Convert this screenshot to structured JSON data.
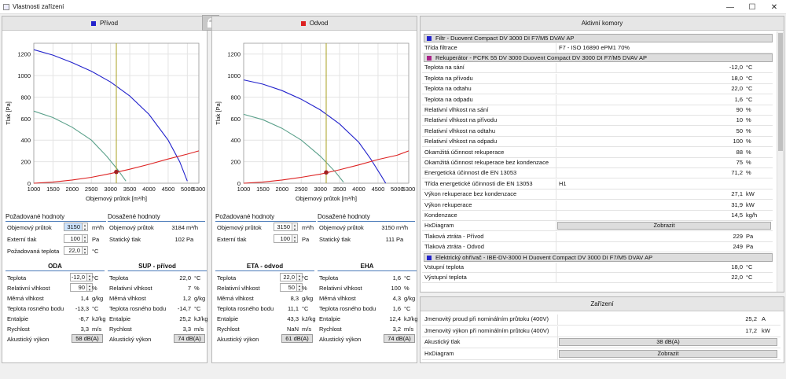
{
  "window": {
    "title": "Vlastnosti zařízení",
    "min": "—",
    "max": "☐",
    "close": "✕"
  },
  "colors": {
    "blue": "#2222cc",
    "red": "#dd2222",
    "green": "#5aa08a",
    "olive": "#aaa020"
  },
  "left": {
    "header": "Přívod",
    "color": "#2222cc",
    "chart_data": {
      "type": "line",
      "xlabel": "Objemový průtok [m³/h]",
      "ylabel": "Tlak [Pa]",
      "xlim": [
        1000,
        5300
      ],
      "ylim": [
        0,
        1300
      ],
      "xticks": [
        1000,
        1500,
        2000,
        2500,
        3000,
        3500,
        4000,
        4500,
        5000,
        5300
      ],
      "yticks": [
        0,
        200,
        400,
        600,
        800,
        1000,
        1200
      ],
      "series": [
        {
          "color": "#2222cc",
          "points": [
            [
              1000,
              1240
            ],
            [
              1500,
              1190
            ],
            [
              2000,
              1120
            ],
            [
              2500,
              1040
            ],
            [
              3000,
              940
            ],
            [
              3500,
              810
            ],
            [
              4000,
              640
            ],
            [
              4500,
              400
            ],
            [
              4800,
              200
            ],
            [
              5000,
              20
            ]
          ]
        },
        {
          "color": "#5aa08a",
          "points": [
            [
              1000,
              670
            ],
            [
              1500,
              610
            ],
            [
              2000,
              520
            ],
            [
              2500,
              400
            ],
            [
              2900,
              250
            ],
            [
              3200,
              120
            ],
            [
              3400,
              20
            ]
          ]
        },
        {
          "color": "#dd2222",
          "points": [
            [
              1000,
              0
            ],
            [
              1500,
              10
            ],
            [
              2000,
              30
            ],
            [
              2500,
              55
            ],
            [
              3000,
              90
            ],
            [
              3500,
              130
            ],
            [
              4000,
              175
            ],
            [
              4500,
              225
            ],
            [
              5000,
              270
            ],
            [
              5300,
              300
            ]
          ]
        }
      ],
      "vline": 3150,
      "point": [
        3150,
        105
      ]
    },
    "req": {
      "title": "Požadované hodnoty",
      "flow_label": "Objemový průtok",
      "flow": "3150",
      "flow_unit": "m³/h",
      "ext_label": "Externí tlak",
      "ext": "100",
      "ext_unit": "Pa",
      "temp_label": "Požadovaná teplota",
      "temp": "22,0",
      "temp_unit": "°C"
    },
    "ach": {
      "title": "Dosažené hodnoty",
      "flow_label": "Objemový průtok",
      "flow": "3184",
      "flow_unit": "m³/h",
      "stat_label": "Statický tlak",
      "stat": "102",
      "stat_unit": "Pa"
    },
    "a": {
      "title": "ODA",
      "rows": [
        {
          "label": "Teplota",
          "value": "-12,0",
          "unit": "°C",
          "input": true
        },
        {
          "label": "Relativní vlhkost",
          "value": "90",
          "unit": "%",
          "input": true
        },
        {
          "label": "Měrná vlhkost",
          "value": "1,4",
          "unit": "g/kg"
        },
        {
          "label": "Teplota rosného bodu",
          "value": "-13,3",
          "unit": "°C"
        },
        {
          "label": "Entalpie",
          "value": "-8,7",
          "unit": "kJ/kg"
        },
        {
          "label": "Rychlost",
          "value": "3,3",
          "unit": "m/s"
        }
      ],
      "ac_label": "Akustický výkon",
      "ac": "58 dB(A)"
    },
    "b": {
      "title": "SUP - přívod",
      "rows": [
        {
          "label": "Teplota",
          "value": "22,0",
          "unit": "°C"
        },
        {
          "label": "Relativní vlhkost",
          "value": "7",
          "unit": "%"
        },
        {
          "label": "Měrná vlhkost",
          "value": "1,2",
          "unit": "g/kg"
        },
        {
          "label": "Teplota rosného bodu",
          "value": "-14,7",
          "unit": "°C"
        },
        {
          "label": "Entalpie",
          "value": "25,2",
          "unit": "kJ/kg"
        },
        {
          "label": "Rychlost",
          "value": "3,3",
          "unit": "m/s"
        }
      ],
      "ac_label": "Akustický výkon",
      "ac": "74 dB(A)"
    }
  },
  "right": {
    "header": "Odvod",
    "color": "#dd2222",
    "chart_data": {
      "type": "line",
      "xlabel": "Objemový průtok [m³/h]",
      "ylabel": "Tlak [Pa]",
      "xlim": [
        1000,
        5300
      ],
      "ylim": [
        0,
        1300
      ],
      "xticks": [
        1000,
        1500,
        2000,
        2500,
        3000,
        3500,
        4000,
        4500,
        5000,
        5300
      ],
      "yticks": [
        0,
        200,
        400,
        600,
        800,
        1000,
        1200
      ],
      "series": [
        {
          "color": "#2222cc",
          "points": [
            [
              1000,
              960
            ],
            [
              1500,
              920
            ],
            [
              2000,
              860
            ],
            [
              2500,
              780
            ],
            [
              3000,
              680
            ],
            [
              3500,
              550
            ],
            [
              4000,
              380
            ],
            [
              4300,
              230
            ],
            [
              4600,
              60
            ],
            [
              4700,
              0
            ]
          ]
        },
        {
          "color": "#5aa08a",
          "points": [
            [
              1000,
              640
            ],
            [
              1500,
              590
            ],
            [
              2000,
              510
            ],
            [
              2500,
              400
            ],
            [
              3000,
              250
            ],
            [
              3400,
              100
            ],
            [
              3600,
              10
            ]
          ]
        },
        {
          "color": "#dd2222",
          "points": [
            [
              1000,
              0
            ],
            [
              1500,
              10
            ],
            [
              2000,
              30
            ],
            [
              2500,
              55
            ],
            [
              3000,
              85
            ],
            [
              3500,
              125
            ],
            [
              4000,
              170
            ],
            [
              4500,
              220
            ],
            [
              5000,
              260
            ],
            [
              5300,
              300
            ]
          ]
        }
      ],
      "vline": 3150,
      "point": [
        3150,
        100
      ]
    },
    "req": {
      "title": "Požadované hodnoty",
      "flow_label": "Objemový průtok",
      "flow": "3150",
      "flow_unit": "m³/h",
      "ext_label": "Externí tlak",
      "ext": "100",
      "ext_unit": "Pa"
    },
    "ach": {
      "title": "Dosažené hodnoty",
      "flow_label": "Objemový průtok",
      "flow": "3150",
      "flow_unit": "m³/h",
      "stat_label": "Statický tlak",
      "stat": "111",
      "stat_unit": "Pa"
    },
    "a": {
      "title": "ETA - odvod",
      "rows": [
        {
          "label": "Teplota",
          "value": "22,0",
          "unit": "°C",
          "input": true
        },
        {
          "label": "Relativní vlhkost",
          "value": "50",
          "unit": "%",
          "input": true
        },
        {
          "label": "Měrná vlhkost",
          "value": "8,3",
          "unit": "g/kg"
        },
        {
          "label": "Teplota rosného bodu",
          "value": "11,1",
          "unit": "°C"
        },
        {
          "label": "Entalpie",
          "value": "43,3",
          "unit": "kJ/kg"
        },
        {
          "label": "Rychlost",
          "value": "NaN",
          "unit": "m/s"
        }
      ],
      "ac_label": "Akustický výkon",
      "ac": "61 dB(A)"
    },
    "b": {
      "title": "EHA",
      "rows": [
        {
          "label": "Teplota",
          "value": "1,6",
          "unit": "°C"
        },
        {
          "label": "Relativní vlhkost",
          "value": "100",
          "unit": "%"
        },
        {
          "label": "Měrná vlhkost",
          "value": "4,3",
          "unit": "g/kg"
        },
        {
          "label": "Teplota rosného bodu",
          "value": "1,6",
          "unit": "°C"
        },
        {
          "label": "Entalpie",
          "value": "12,4",
          "unit": "kJ/kg"
        },
        {
          "label": "Rychlost",
          "value": "3,2",
          "unit": "m/s"
        }
      ],
      "ac_label": "Akustický výkon",
      "ac": "74 dB(A)"
    }
  },
  "active": {
    "header": "Aktivní komory",
    "filter": {
      "title": "Filtr - Duovent Compact DV 3000 DI F7/M5 DVAV AP",
      "color": "#2222cc",
      "rows": [
        {
          "label": "Třída filtrace",
          "value": "F7 - ISO 16890 ePM1 70%",
          "align": "left"
        }
      ]
    },
    "recup": {
      "title": "Rekuperátor - PCFK 55 DV 3000 Duovent Compact DV 3000 DI F7/M5 DVAV AP",
      "color": "#aa2288",
      "rows": [
        {
          "label": "Teplota na sání",
          "value": "-12,0",
          "unit": "°C"
        },
        {
          "label": "Teplota na přívodu",
          "value": "18,0",
          "unit": "°C"
        },
        {
          "label": "Teplota na odtahu",
          "value": "22,0",
          "unit": "°C"
        },
        {
          "label": "Teplota na odpadu",
          "value": "1,6",
          "unit": "°C"
        },
        {
          "label": "Relativní vlhkost na sání",
          "value": "90",
          "unit": "%"
        },
        {
          "label": "Relativní vlhkost na přívodu",
          "value": "10",
          "unit": "%"
        },
        {
          "label": "Relativní vlhkost na odtahu",
          "value": "50",
          "unit": "%"
        },
        {
          "label": "Relativní vlhkost na odpadu",
          "value": "100",
          "unit": "%"
        },
        {
          "label": "Okamžitá účinnost rekuperace",
          "value": "88",
          "unit": "%"
        },
        {
          "label": "Okamžitá účinnost rekuperace bez kondenzace",
          "value": "75",
          "unit": "%"
        },
        {
          "label": "Energetická účinnost dle EN 13053",
          "value": "71,2",
          "unit": "%"
        },
        {
          "label": "Třída energetické účinnosti dle EN 13053",
          "value": "H1",
          "align": "left"
        },
        {
          "label": "Výkon rekuperace bez kondenzace",
          "value": "27,1",
          "unit": "kW"
        },
        {
          "label": "Výkon rekuperace",
          "value": "31,9",
          "unit": "kW"
        },
        {
          "label": "Kondenzace",
          "value": "14,5",
          "unit": "kg/h"
        },
        {
          "label": "HxDiagram",
          "button": "Zobrazit"
        },
        {
          "label": "Tlaková ztráta - Přívod",
          "value": "229",
          "unit": "Pa"
        },
        {
          "label": "Tlaková ztráta - Odvod",
          "value": "249",
          "unit": "Pa"
        }
      ]
    },
    "heater": {
      "title": "Elektrický ohřívač - IBE-DV-3000 H Duovent Compact DV 3000 DI F7/M5 DVAV AP",
      "color": "#2222cc",
      "rows": [
        {
          "label": "Vstupní teplota",
          "value": "18,0",
          "unit": "°C"
        },
        {
          "label": "Výstupní teplota",
          "value": "22,0",
          "unit": "°C"
        }
      ]
    }
  },
  "device": {
    "header": "Zařízení",
    "rows": [
      {
        "label": "Jmenovitý proud při nominálním průtoku (400V)",
        "value": "25,2",
        "unit": "A"
      },
      {
        "label": "Jmenovitý výkon při nominálním průtoku (400V)",
        "value": "17,2",
        "unit": "kW"
      },
      {
        "label": "Akustický tlak",
        "button": "38 dB(A)"
      },
      {
        "label": "HxDiagram",
        "button": "Zobrazit"
      }
    ]
  }
}
